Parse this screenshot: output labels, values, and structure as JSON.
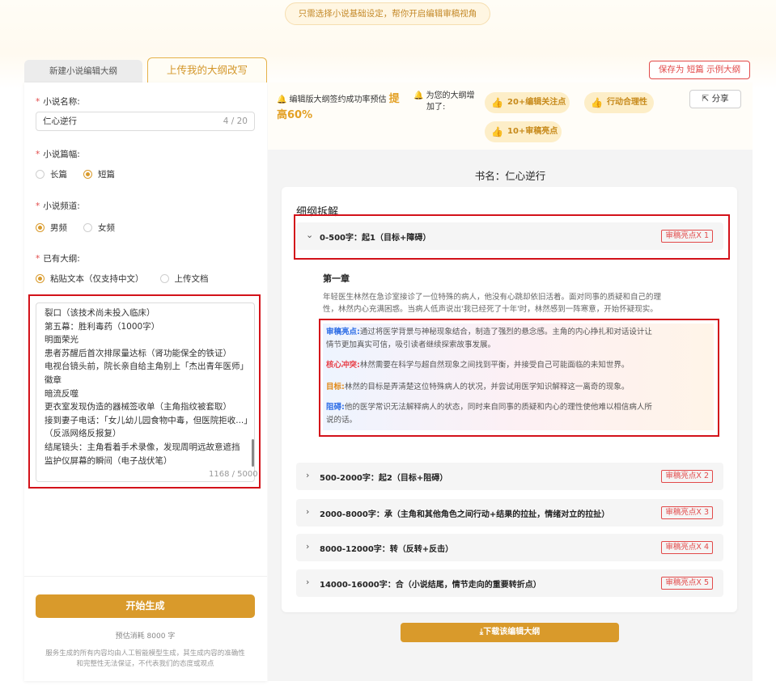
{
  "banner": {
    "text": "只需选择小说基础设定，帮你开启编辑审稿视角"
  },
  "tabs": {
    "left": "新建小说编辑大纲",
    "right": "上传我的大纲改写"
  },
  "save_button": "保存为 短篇 示例大纲",
  "form": {
    "name_label": "小说名称:",
    "name_value": "仁心逆行",
    "name_count": "4 / 20",
    "length_label": "小说篇幅:",
    "length_options": [
      "长篇",
      "短篇"
    ],
    "length_selected": "短篇",
    "channel_label": "小说频道:",
    "channel_options": [
      "男频",
      "女频"
    ],
    "channel_selected": "男频",
    "outline_label": "已有大纲:",
    "outline_options": [
      "粘贴文本（仅支持中文）",
      "上传文档"
    ],
    "outline_selected": "粘贴文本（仅支持中文）",
    "outline_lines": [
      "裂口（该技术尚未投入临床）",
      "第五幕：胜利毒药（1000字）",
      "明面荣光",
      "患者苏醒后首次排尿量达标（肾功能保全的铁证）",
      "电视台镜头前，院长亲自给主角别上「杰出青年医师」",
      "徽章",
      "暗流反噬",
      "更衣室发现伪造的器械签收单（主角指纹被套取）",
      "接到妻子电话：「女儿幼儿园食物中毒，但医院拒收...」",
      "（反派网络反报复）",
      "结尾镜头：主角看着手术录像，发现周明远故意遮挡",
      "监护仪屏幕的瞬间（电子战伏笔）"
    ],
    "outline_count": "1168 / 5000"
  },
  "footer": {
    "start_button": "开始生成",
    "cost": "预估消耗 8000 字",
    "disclaimer_1": "服务生成的所有内容均由人工智能模型生成，其生成内容的准确性",
    "disclaimer_2": "和完整性无法保证，不代表我们的态度或观点"
  },
  "header": {
    "stat_prefix": "编辑版大纲签约成功率预估",
    "stat_up": "提",
    "stat_value": "高60%",
    "added_1": "为您的大纲增",
    "added_2": "加了:",
    "chips": [
      "20+编辑关注点",
      "行动合理性",
      "10+审稿亮点"
    ],
    "share": "分享"
  },
  "book": {
    "name": "书名：仁心逆行"
  },
  "outline": {
    "title": "细纲拆解",
    "sections": [
      {
        "label": "0-500字：起1（目标+障碍）",
        "badge": "审稿亮点X 1",
        "expanded": true
      },
      {
        "label": "500-2000字：起2（目标+阻碍）",
        "badge": "审稿亮点X 2",
        "expanded": false
      },
      {
        "label": "2000-8000字：承（主角和其他角色之间行动+结果的拉扯，情绪对立的拉扯）",
        "badge": "审稿亮点X 3",
        "expanded": false
      },
      {
        "label": "8000-12000字：转（反转+反击）",
        "badge": "审稿亮点X 4",
        "expanded": false
      },
      {
        "label": "14000-16000字：合（小说结尾，情节走向的重要转折点）",
        "badge": "审稿亮点X 5",
        "expanded": false
      }
    ],
    "chapter_title": "第一章",
    "chapter_line_1": "年轻医生林然在急诊室接诊了一位特殊的病人，他没有心跳却依旧活着。面对同事的质疑和自己的理",
    "chapter_line_2": "性，林然内心充满困惑。当病人低声说出'我已经死了十年'时，林然感到一阵寒意，开始怀疑现实。",
    "highlights": [
      {
        "key": "审稿亮点:",
        "line_1": "通过将医学背景与神秘现象结合，制造了强烈的悬念感。主角的内心挣扎和对话设计让",
        "line_2": "情节更加真实可信，吸引读者继续探索故事发展。"
      },
      {
        "key": "核心冲突:",
        "line_1": "林然需要在科学与超自然现象之间找到平衡，并接受自己可能面临的未知世界。",
        "line_2": ""
      },
      {
        "key": "目标:",
        "line_1": "林然的目标是弄清楚这位特殊病人的状况，并尝试用医学知识解释这一离奇的现象。",
        "line_2": ""
      },
      {
        "key": "阻碍:",
        "line_1": "他的医学常识无法解释病人的状态，同时来自同事的质疑和内心的理性使他难以相信病人所",
        "line_2": "说的话。"
      }
    ],
    "download_button": "下载该编辑大纲"
  },
  "colors": {
    "accent": "#d99a2b",
    "highlight_red": "#d3121a",
    "badge_red": "#e24a4a"
  },
  "icons": {
    "bell": "bell-icon",
    "thumb": "thumbs-up-icon",
    "share": "share-icon",
    "download": "download-icon",
    "chevron": "chevron-icon"
  }
}
